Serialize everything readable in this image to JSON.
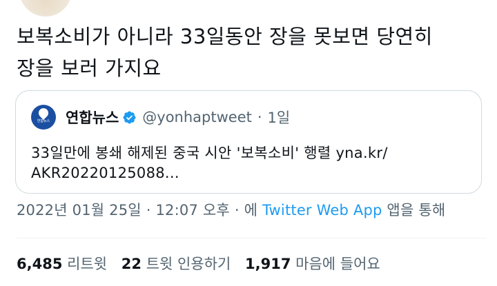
{
  "tweet": {
    "text_line1": "보복소비가 아니라 33일동안 장을 못보면 당연히",
    "text_line2": "장을 보러 가지요"
  },
  "quoted_tweet": {
    "logo_text": "연합뉴스",
    "display_name": "연합뉴스",
    "handle": "@yonhaptweet",
    "separator": "·",
    "time": "1일",
    "body_line1": "33일만에 봉쇄 해제된 중국 시안 '보복소비' 행렬 yna.kr/",
    "body_line2": "AKR20220125088..."
  },
  "meta": {
    "date": "2022년 01월 25일",
    "separator": "·",
    "time": "12:07 오후",
    "via_prefix": "· 에",
    "source": "Twitter Web App",
    "via_suffix": "앱을 통해"
  },
  "stats": {
    "retweets_count": "6,485",
    "retweets_label": "리트윗",
    "quotes_count": "22",
    "quotes_label": "트윗 인용하기",
    "likes_count": "1,917",
    "likes_label": "마음에 들어요"
  },
  "colors": {
    "accent": "#1d9bf0",
    "secondary_text": "#536471",
    "border": "#cfd9de",
    "logo_blue": "#1b4fa2"
  },
  "icons": {
    "verified": "verified-badge-icon",
    "avatar": "avatar"
  }
}
